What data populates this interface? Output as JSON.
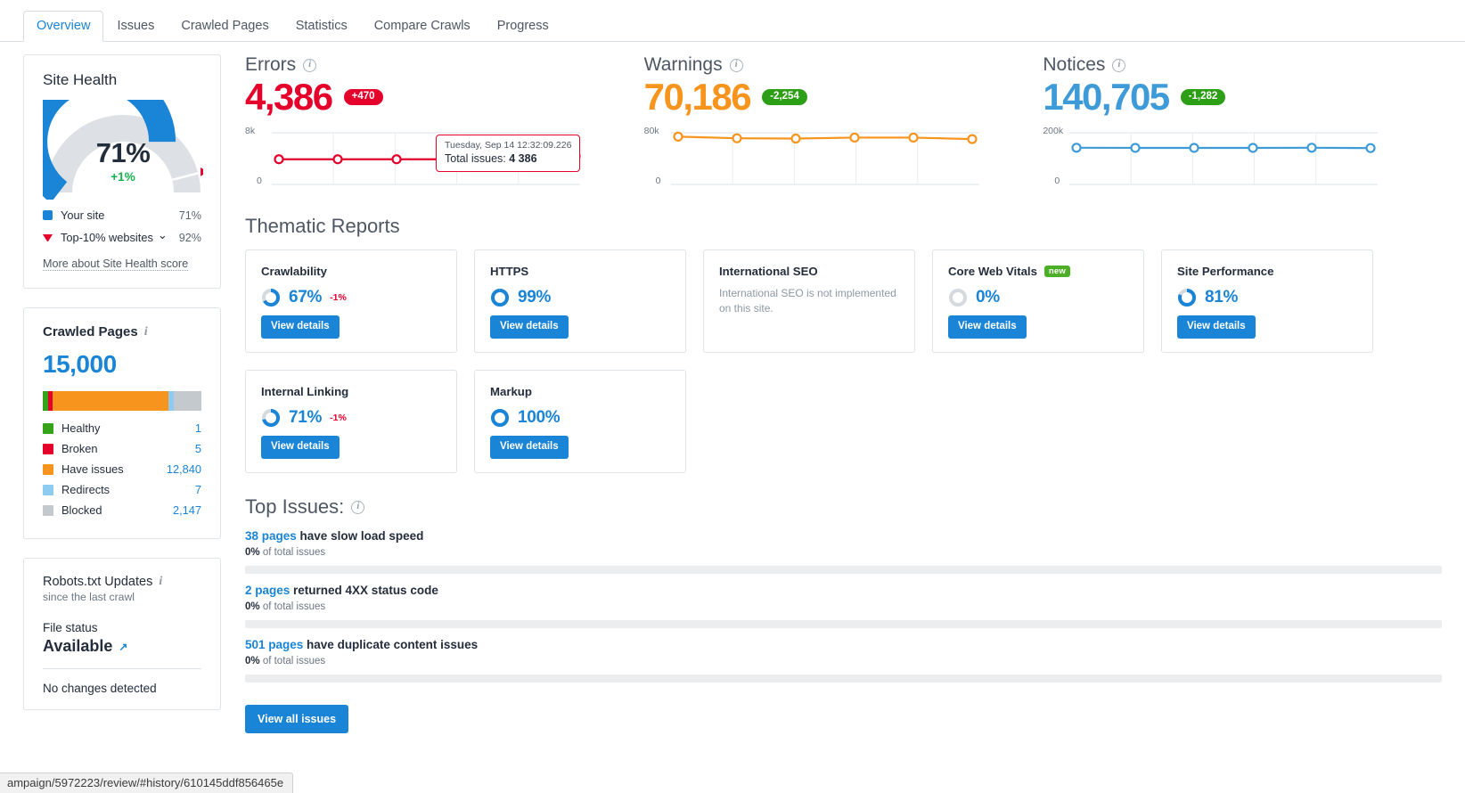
{
  "tabs": [
    {
      "label": "Overview",
      "active": true
    },
    {
      "label": "Issues",
      "active": false
    },
    {
      "label": "Crawled Pages",
      "active": false
    },
    {
      "label": "Statistics",
      "active": false
    },
    {
      "label": "Compare Crawls",
      "active": false
    },
    {
      "label": "Progress",
      "active": false
    }
  ],
  "site_health": {
    "title": "Site Health",
    "percent": "71%",
    "delta": "+1%",
    "gauge_value": 71,
    "benchmark_value": 92,
    "legend": [
      {
        "label": "Your site",
        "value": "71%",
        "color": "#1a84d6",
        "type": "swatch"
      },
      {
        "label": "Top-10% websites",
        "value": "92%",
        "color": "#e4002b",
        "type": "triangle",
        "has_chevron": true
      }
    ],
    "more_link": "More about Site Health score"
  },
  "crawled_pages": {
    "title": "Crawled Pages",
    "total": "15,000",
    "segments": [
      {
        "label": "Healthy",
        "value": "1",
        "color": "#34a318",
        "pct": 3.2
      },
      {
        "label": "Broken",
        "value": "5",
        "color": "#e4002b",
        "pct": 3.2
      },
      {
        "label": "Have issues",
        "value": "12,840",
        "color": "#f7941d",
        "pct": 73.0
      },
      {
        "label": "Redirects",
        "value": "7",
        "color": "#8ecbf0",
        "pct": 3.2
      },
      {
        "label": "Blocked",
        "value": "2,147",
        "color": "#c4c9ce",
        "pct": 17.4
      }
    ]
  },
  "robots": {
    "title": "Robots.txt Updates",
    "subtitle": "since the last crawl",
    "file_status_label": "File status",
    "file_status_value": "Available",
    "changes": "No changes detected"
  },
  "kpis": [
    {
      "name": "Errors",
      "value": "4,386",
      "badge": "+470",
      "badge_color": "#e4002b",
      "color": "#e4002b",
      "axis_max_label": "8k",
      "axis_min_label": "0"
    },
    {
      "name": "Warnings",
      "value": "70,186",
      "badge": "-2,254",
      "badge_color": "#2d9f16",
      "color": "#f7941d",
      "axis_max_label": "80k",
      "axis_min_label": "0"
    },
    {
      "name": "Notices",
      "value": "140,705",
      "badge": "-1,282",
      "badge_color": "#2d9f16",
      "color": "#3e9bd8",
      "axis_max_label": "200k",
      "axis_min_label": "0"
    }
  ],
  "tooltip": {
    "date": "Tuesday, Sep 14 12:32:09.226",
    "label": "Total issues:",
    "value": "4 386"
  },
  "thematic": {
    "title": "Thematic Reports",
    "cards": [
      {
        "title": "Crawlability",
        "pct": "67%",
        "pct_num": 67,
        "delta": "-1%",
        "button": "View details",
        "badge": null,
        "desc": null
      },
      {
        "title": "HTTPS",
        "pct": "99%",
        "pct_num": 99,
        "delta": null,
        "button": "View details",
        "badge": null,
        "desc": null
      },
      {
        "title": "International SEO",
        "pct": null,
        "pct_num": null,
        "delta": null,
        "button": null,
        "badge": null,
        "desc": "International SEO is not implemented on this site."
      },
      {
        "title": "Core Web Vitals",
        "pct": "0%",
        "pct_num": 0,
        "delta": null,
        "button": "View details",
        "badge": "new",
        "desc": null
      },
      {
        "title": "Site Performance",
        "pct": "81%",
        "pct_num": 81,
        "delta": null,
        "button": "View details",
        "badge": null,
        "desc": null
      },
      {
        "title": "Internal Linking",
        "pct": "71%",
        "pct_num": 71,
        "delta": "-1%",
        "button": "View details",
        "badge": null,
        "desc": null
      },
      {
        "title": "Markup",
        "pct": "100%",
        "pct_num": 100,
        "delta": null,
        "button": "View details",
        "badge": null,
        "desc": null
      }
    ]
  },
  "top_issues": {
    "title": "Top Issues:",
    "items": [
      {
        "link": "38 pages",
        "rest": " have slow load speed",
        "pct": "0%",
        "sub": " of total issues",
        "fill": 0
      },
      {
        "link": "2 pages",
        "rest": " returned 4XX status code",
        "pct": "0%",
        "sub": " of total issues",
        "fill": 0
      },
      {
        "link": "501 pages",
        "rest": " have duplicate content issues",
        "pct": "0%",
        "sub": " of total issues",
        "fill": 0
      }
    ],
    "view_all": "View all issues"
  },
  "statusbar": {
    "url": "ampaign/5972223/review/#history/610145ddf856465e"
  },
  "chart_data": [
    {
      "type": "line",
      "title": "Errors",
      "ylabel": "",
      "ylim": [
        0,
        8000
      ],
      "ytick_labels": [
        "0",
        "8k"
      ],
      "grid": true,
      "x": [
        1,
        2,
        3,
        4,
        5,
        6
      ],
      "values": [
        3900,
        3900,
        3900,
        3900,
        3900,
        4386
      ],
      "color": "#e4002b",
      "highlight_index": 5
    },
    {
      "type": "line",
      "title": "Warnings",
      "ylabel": "",
      "ylim": [
        0,
        80000
      ],
      "ytick_labels": [
        "0",
        "80k"
      ],
      "grid": true,
      "x": [
        1,
        2,
        3,
        4,
        5,
        6
      ],
      "values": [
        74000,
        71500,
        71000,
        72500,
        72500,
        70186
      ],
      "color": "#f7941d",
      "highlight_index": null
    },
    {
      "type": "line",
      "title": "Notices",
      "ylabel": "",
      "ylim": [
        0,
        200000
      ],
      "ytick_labels": [
        "0",
        "200k"
      ],
      "grid": true,
      "x": [
        1,
        2,
        3,
        4,
        5,
        6
      ],
      "values": [
        142000,
        141500,
        141500,
        141500,
        142000,
        140705
      ],
      "color": "#3e9bd8",
      "highlight_index": null
    }
  ]
}
